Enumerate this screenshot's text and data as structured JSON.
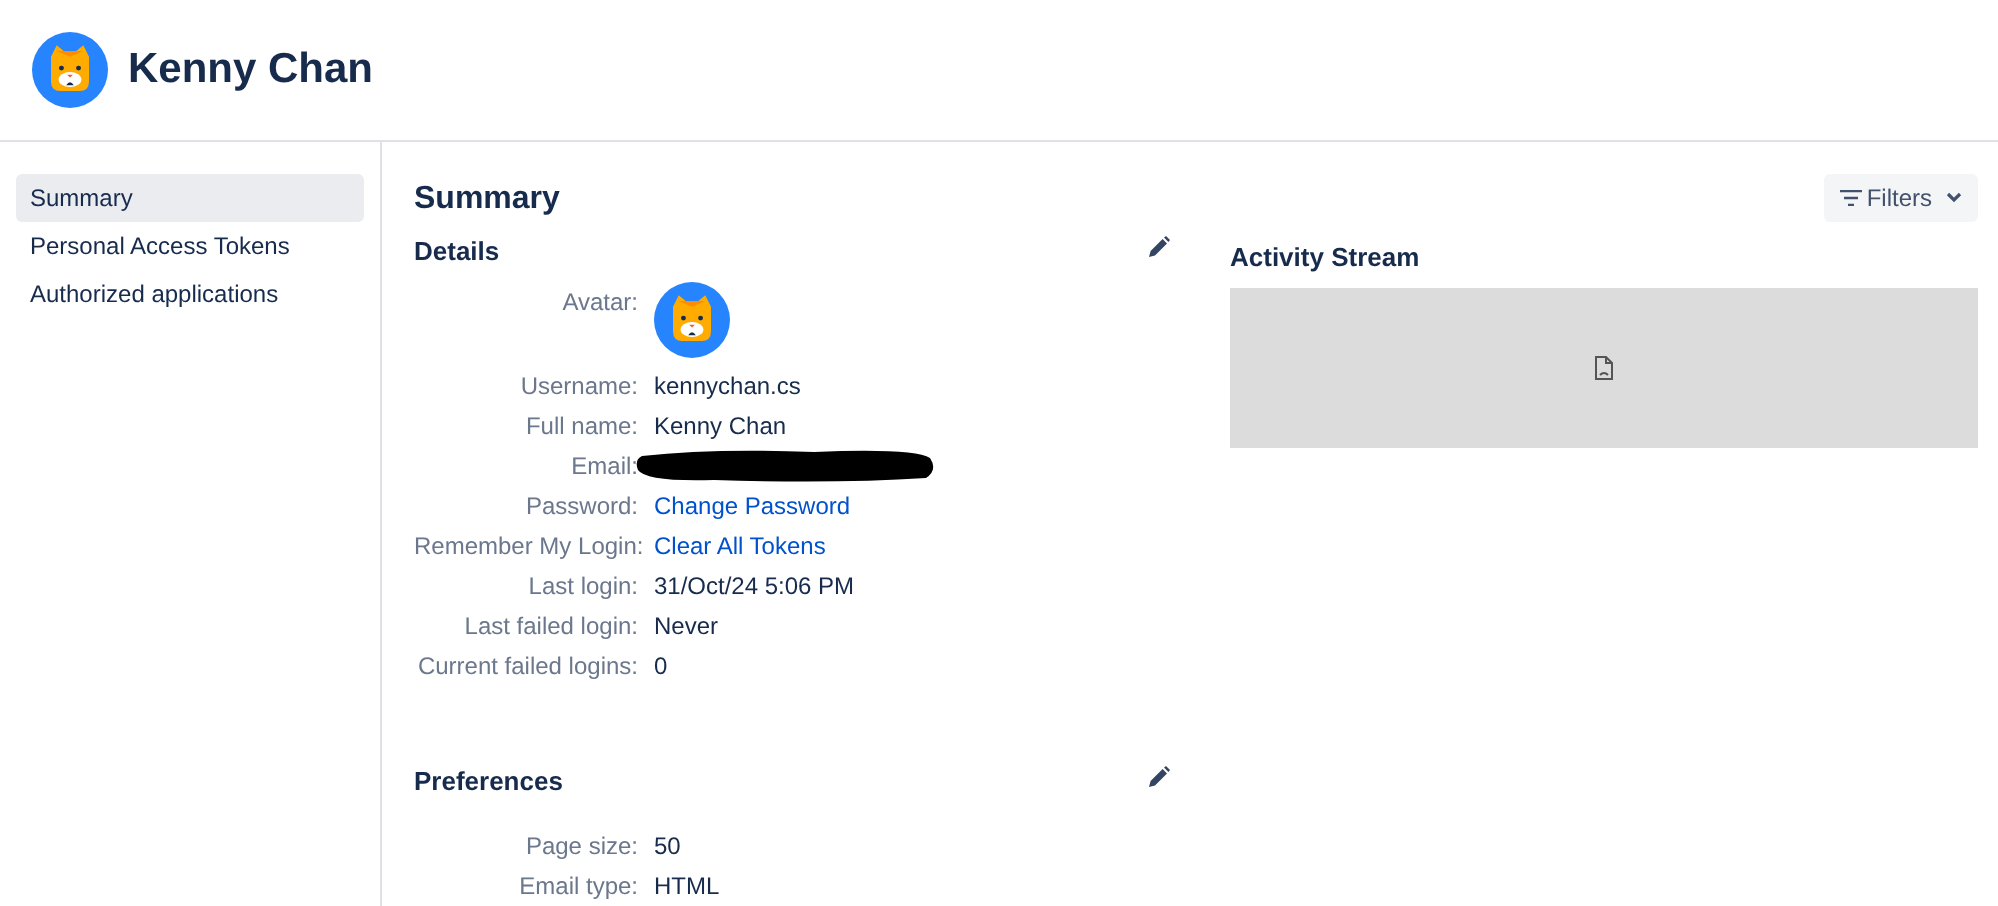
{
  "header": {
    "name": "Kenny Chan"
  },
  "sidebar": {
    "items": [
      {
        "label": "Summary",
        "selected": true
      },
      {
        "label": "Personal Access Tokens",
        "selected": false
      },
      {
        "label": "Authorized applications",
        "selected": false
      }
    ]
  },
  "page_title": "Summary",
  "filters_button": "Filters",
  "details": {
    "title": "Details",
    "fields": [
      {
        "label": "Avatar:",
        "kind": "avatar"
      },
      {
        "label": "Username:",
        "kind": "text",
        "value": "kennychan.cs"
      },
      {
        "label": "Full name:",
        "kind": "text",
        "value": "Kenny Chan"
      },
      {
        "label": "Email:",
        "kind": "redacted"
      },
      {
        "label": "Password:",
        "kind": "link",
        "value": "Change Password"
      },
      {
        "label": "Remember My Login:",
        "kind": "link",
        "value": "Clear All Tokens"
      },
      {
        "label": "Last login:",
        "kind": "text",
        "value": "31/Oct/24 5:06 PM"
      },
      {
        "label": "Last failed login:",
        "kind": "text",
        "value": "Never"
      },
      {
        "label": "Current failed logins:",
        "kind": "text",
        "value": "0"
      }
    ]
  },
  "preferences": {
    "title": "Preferences",
    "fields": [
      {
        "label": "Page size:",
        "kind": "text",
        "value": "50"
      },
      {
        "label": "Email type:",
        "kind": "text",
        "value": "HTML"
      }
    ]
  },
  "activity_stream": {
    "title": "Activity Stream"
  }
}
